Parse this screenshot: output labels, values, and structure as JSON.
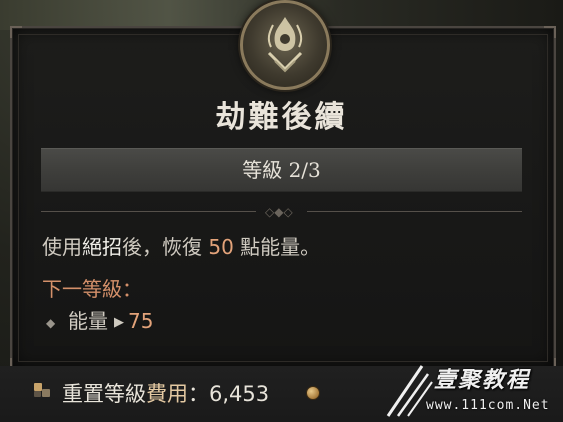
{
  "tooltip": {
    "title": "劫難後續",
    "rank_label": "等級 2/3",
    "description": {
      "prefix": "使用",
      "keyword": "絕招",
      "middle": "後，恢復 ",
      "value": "50",
      "suffix": " 點能量。"
    },
    "next_rank": {
      "label": "下一等級：",
      "stat_name": "能量",
      "stat_value": "75"
    },
    "reset": {
      "label_prefix": "重置等級",
      "label_gold": "費用",
      "label_suffix": "：6,453"
    },
    "icons": {
      "emblem": "skill-emblem-icon",
      "bullet": "bullet-icon",
      "arrow": "arrow-right-icon",
      "reset": "respec-icon",
      "coin": "gold-coin-icon"
    }
  },
  "watermark": {
    "title": "壹聚教程",
    "url": "www.111com.Net"
  },
  "colors": {
    "title": "#e9e4da",
    "highlight_orange": "#e3a37a",
    "next_label": "#d4906a",
    "frame": "#4a4540"
  }
}
